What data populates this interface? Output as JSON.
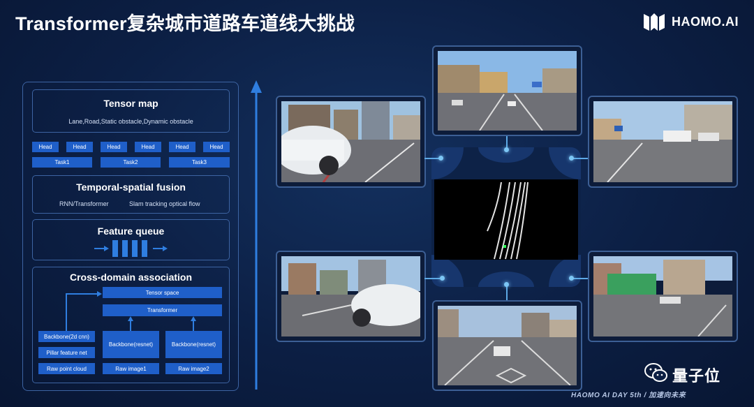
{
  "header": {
    "title": "Transformer复杂城市道路车道线大挑战",
    "brand": "HAOMO.AI"
  },
  "architecture": {
    "tensor_map": {
      "title": "Tensor map",
      "subtitle": "Lane,Road,Static obstacle,Dynamic obstacle"
    },
    "heads": [
      "Head",
      "Head",
      "Head",
      "Head",
      "Head",
      "Head"
    ],
    "tasks": [
      "Task1",
      "Task2",
      "Task3"
    ],
    "fusion": {
      "title": "Temporal-spatial fusion",
      "sub_left": "RNN/Transformer",
      "sub_right": "Slam tracking optical flow"
    },
    "queue": {
      "title": "Feature queue"
    },
    "cross_domain": {
      "title": "Cross-domain association",
      "tensor_space": "Tensor space",
      "transformer": "Transformer",
      "backbone_cnn": "Backbone(2d cnn)",
      "pillar": "Pillar feature net",
      "raw_cloud": "Raw point cloud",
      "backbone_resnet_1": "Backbone(resnet)",
      "backbone_resnet_2": "Backbone(resnet)",
      "raw_image_1": "Raw image1",
      "raw_image_2": "Raw image2"
    }
  },
  "footer": {
    "watermark": "量子位",
    "event": "HAOMO AI DAY 5th / 加速向未来"
  },
  "colors": {
    "background": "#0c1f44",
    "chip_blue": "#1f5fc9",
    "border_blue": "#3d64a3",
    "accent_cyan": "#7cc6f5"
  }
}
